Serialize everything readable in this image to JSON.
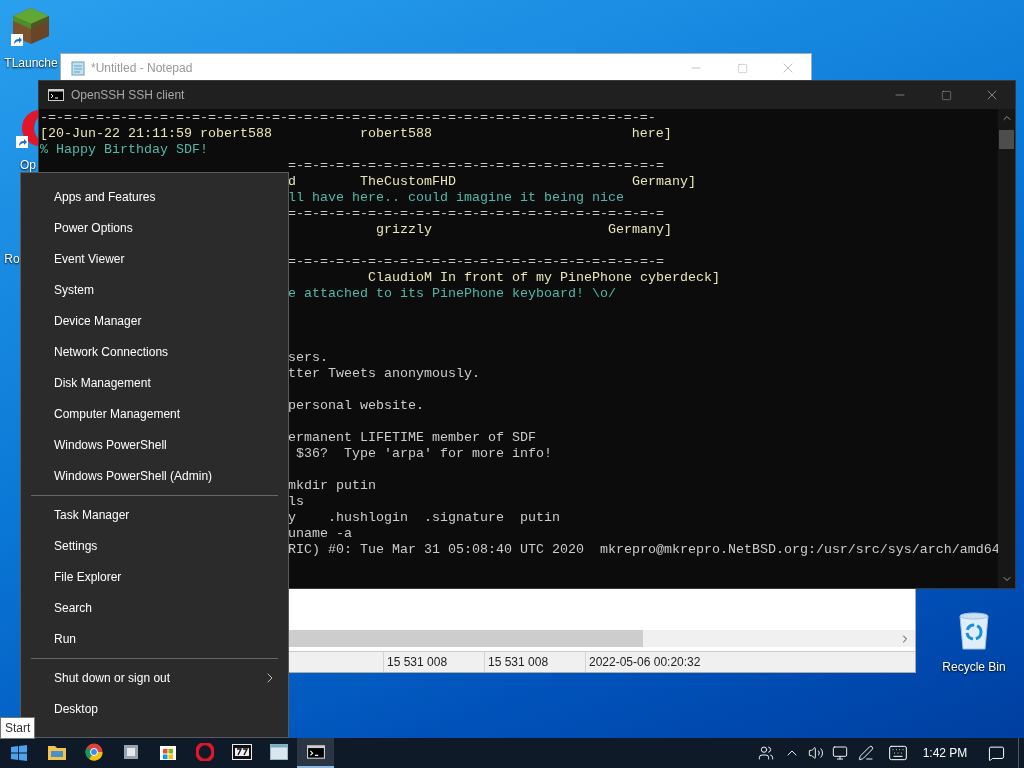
{
  "desktop_icons": [
    {
      "kind": "grass-block",
      "label": "TLaunche"
    },
    {
      "kind": "opera",
      "label": "Op"
    },
    {
      "kind": "generic",
      "label": "Ro"
    },
    {
      "kind": "recycle",
      "label": "Recycle Bin"
    }
  ],
  "notepad": {
    "title": "*Untitled - Notepad"
  },
  "explorer_window": {
    "status_cells": [
      "15 531 008",
      "15 531 008",
      "2022-05-06 00:20:32"
    ]
  },
  "terminal": {
    "title": "OpenSSH SSH client",
    "lines": [
      {
        "kind": "full",
        "text": "-=-=-=-=-=-=-=-=-=-=-=-=-=-=-=-=-=-=-=-=-=-=-=-=-=-=-=-=-=-=-=-=-=-=-=-=-=-=-",
        "color": "#c8c8c8"
      },
      {
        "kind": "full",
        "text": "[20-Jun-22 21:11:59 robert588           robert588                         here]",
        "color": "#e8e6b8"
      },
      {
        "kind": "full",
        "text": "% Happy Birthday SDF!",
        "color": "#4fb8aa"
      },
      {
        "kind": "clipped",
        "text": "=-=-=-=-=-=-=-=-=-=-=-=-=-=-=-=-=-=-=-=-=-=-=-=",
        "color": "#c8c8c8"
      },
      {
        "kind": "clipped",
        "text": "d        TheCustomFHD                      Germany]",
        "color": "#e8e6b8"
      },
      {
        "kind": "clipped",
        "text": "ll have here.. could imagine it being nice",
        "color": "#4fb8aa"
      },
      {
        "kind": "clipped",
        "text": "=-=-=-=-=-=-=-=-=-=-=-=-=-=-=-=-=-=-=-=-=-=-=-=",
        "color": "#c8c8c8"
      },
      {
        "kind": "clipped",
        "text": "           grizzly                      Germany]",
        "color": "#e8e6b8"
      },
      {
        "kind": "blank"
      },
      {
        "kind": "clipped",
        "text": "=-=-=-=-=-=-=-=-=-=-=-=-=-=-=-=-=-=-=-=-=-=-=-=",
        "color": "#c8c8c8"
      },
      {
        "kind": "clipped",
        "text": "          ClaudioM In front of my PinePhone cyberdeck]",
        "color": "#e8e6b8"
      },
      {
        "kind": "clipped",
        "text": "e attached to its PinePhone keyboard! \\o/",
        "color": "#4fb8aa"
      },
      {
        "kind": "blank"
      },
      {
        "kind": "blank"
      },
      {
        "kind": "blank"
      },
      {
        "kind": "clipped",
        "text": "sers.",
        "color": "#cccccc"
      },
      {
        "kind": "clipped",
        "text": "tter Tweets anonymously.",
        "color": "#cccccc"
      },
      {
        "kind": "blank"
      },
      {
        "kind": "clipped",
        "text": "personal website.",
        "color": "#cccccc"
      },
      {
        "kind": "blank"
      },
      {
        "kind": "clipped",
        "text": "ermanent LIFETIME member of SDF",
        "color": "#cccccc"
      },
      {
        "kind": "clipped",
        "text": " $36?  Type 'arpa' for more info!",
        "color": "#cccccc"
      },
      {
        "kind": "blank"
      },
      {
        "kind": "clipped",
        "text": "mkdir putin",
        "color": "#cccccc"
      },
      {
        "kind": "clipped",
        "text": "ls",
        "color": "#cccccc"
      },
      {
        "kind": "clipped",
        "text": "y    .hushlogin  .signature  putin",
        "color": "#cccccc"
      },
      {
        "kind": "clipped",
        "text": "uname -a",
        "color": "#cccccc"
      },
      {
        "kind": "clipped",
        "text": "RIC) #0: Tue Mar 31 05:08:40 UTC 2020  mkrepro@mkrepro.NetBSD.org:/usr/src/sys/arch/amd64",
        "color": "#cccccc"
      }
    ]
  },
  "context_menu": {
    "groups": [
      [
        {
          "label": "Apps and Features",
          "submenu": false
        },
        {
          "label": "Power Options",
          "submenu": false
        },
        {
          "label": "Event Viewer",
          "submenu": false
        },
        {
          "label": "System",
          "submenu": false
        },
        {
          "label": "Device Manager",
          "submenu": false
        },
        {
          "label": "Network Connections",
          "submenu": false
        },
        {
          "label": "Disk Management",
          "submenu": false
        },
        {
          "label": "Computer Management",
          "submenu": false
        },
        {
          "label": "Windows PowerShell",
          "submenu": false
        },
        {
          "label": "Windows PowerShell (Admin)",
          "submenu": false
        }
      ],
      [
        {
          "label": "Task Manager",
          "submenu": false
        },
        {
          "label": "Settings",
          "submenu": false
        },
        {
          "label": "File Explorer",
          "submenu": false
        },
        {
          "label": "Search",
          "submenu": false
        },
        {
          "label": "Run",
          "submenu": false
        }
      ],
      [
        {
          "label": "Shut down or sign out",
          "submenu": true
        },
        {
          "label": "Desktop",
          "submenu": false
        }
      ]
    ]
  },
  "tooltip": {
    "text": "Start"
  },
  "taskbar": {
    "apps": [
      {
        "kind": "folder",
        "active": false
      },
      {
        "kind": "browser",
        "active": false
      },
      {
        "kind": "app",
        "active": false
      },
      {
        "kind": "store",
        "active": false
      },
      {
        "kind": "opera",
        "active": false
      },
      {
        "kind": "archive",
        "active": false
      },
      {
        "kind": "window",
        "active": false
      },
      {
        "kind": "console",
        "active": true
      }
    ],
    "clock": "1:42 PM"
  }
}
